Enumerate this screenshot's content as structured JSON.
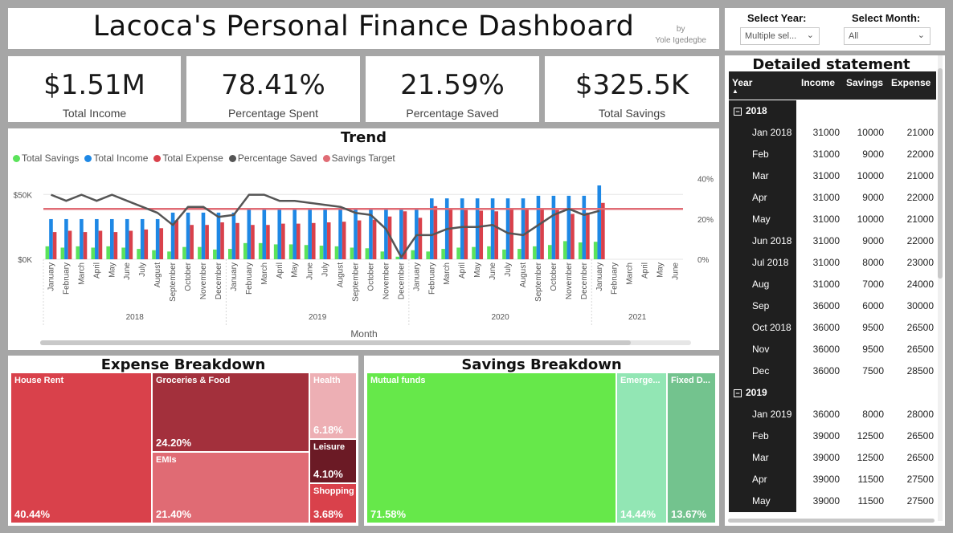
{
  "header": {
    "title": "Lacoca's Personal Finance Dashboard",
    "by_label": "by",
    "author": "Yole Igedegbe"
  },
  "filters": {
    "year_label": "Select Year:",
    "year_value": "Multiple sel...",
    "month_label": "Select Month:",
    "month_value": "All"
  },
  "kpis": [
    {
      "value": "$1.51M",
      "label": "Total Income"
    },
    {
      "value": "78.41%",
      "label": "Percentage Spent"
    },
    {
      "value": "21.59%",
      "label": "Percentage Saved"
    },
    {
      "value": "$325.5K",
      "label": "Total Savings"
    }
  ],
  "trend": {
    "title": "Trend",
    "legend": [
      {
        "name": "Total Savings",
        "color": "#5be35b"
      },
      {
        "name": "Total Income",
        "color": "#1e88e5"
      },
      {
        "name": "Total Expense",
        "color": "#d9414b"
      },
      {
        "name": "Percentage Saved",
        "color": "#555555"
      },
      {
        "name": "Savings Target",
        "color": "#e06c75"
      }
    ],
    "y_left_ticks": [
      "$50K",
      "$0K"
    ],
    "y_right_ticks": [
      "40%",
      "20%",
      "0%"
    ],
    "x_title": "Month",
    "years": [
      "2018",
      "2019",
      "2020",
      "2021"
    ]
  },
  "chart_data": {
    "type": "bar",
    "title": "Trend",
    "xlabel": "Month",
    "ylabel": "",
    "ylim": [
      0,
      70000
    ],
    "y2lim": [
      0,
      0.45
    ],
    "categories": [
      "January",
      "February",
      "March",
      "April",
      "May",
      "June",
      "July",
      "August",
      "September",
      "October",
      "November",
      "December",
      "January",
      "February",
      "March",
      "April",
      "May",
      "June",
      "July",
      "August",
      "September",
      "October",
      "November",
      "December",
      "January",
      "February",
      "March",
      "April",
      "May",
      "June",
      "July",
      "August",
      "September",
      "October",
      "November",
      "December",
      "January",
      "February",
      "March",
      "April",
      "May",
      "June"
    ],
    "category_years": [
      "2018",
      "2018",
      "2018",
      "2018",
      "2018",
      "2018",
      "2018",
      "2018",
      "2018",
      "2018",
      "2018",
      "2018",
      "2019",
      "2019",
      "2019",
      "2019",
      "2019",
      "2019",
      "2019",
      "2019",
      "2019",
      "2019",
      "2019",
      "2019",
      "2020",
      "2020",
      "2020",
      "2020",
      "2020",
      "2020",
      "2020",
      "2020",
      "2020",
      "2020",
      "2020",
      "2020",
      "2021",
      "2021",
      "2021",
      "2021",
      "2021",
      "2021"
    ],
    "series": [
      {
        "name": "Total Savings",
        "axis": "left",
        "kind": "bar",
        "values": [
          10000,
          9000,
          10000,
          9000,
          10000,
          9000,
          8000,
          7000,
          6000,
          9500,
          9500,
          7500,
          8000,
          12500,
          12500,
          11500,
          11500,
          11000,
          10500,
          10000,
          9000,
          8500,
          6000,
          2000,
          7000,
          6000,
          8000,
          9000,
          9500,
          10000,
          7500,
          8000,
          10000,
          11000,
          14000,
          13000,
          13500,
          null,
          null,
          null,
          null,
          null
        ]
      },
      {
        "name": "Total Income",
        "axis": "left",
        "kind": "bar",
        "values": [
          31000,
          31000,
          31000,
          31000,
          31000,
          31000,
          31000,
          31000,
          36000,
          36000,
          36000,
          36000,
          36000,
          39000,
          39000,
          39000,
          39000,
          39000,
          39000,
          39000,
          39000,
          39000,
          39000,
          39000,
          39000,
          47000,
          47000,
          47000,
          47000,
          47000,
          47000,
          47000,
          49000,
          49000,
          49000,
          49000,
          57000,
          null,
          null,
          null,
          null,
          null
        ]
      },
      {
        "name": "Total Expense",
        "axis": "left",
        "kind": "bar",
        "values": [
          21000,
          22000,
          21000,
          22000,
          21000,
          22000,
          23000,
          24000,
          30000,
          26500,
          26500,
          28500,
          28000,
          26500,
          26500,
          27500,
          27500,
          28000,
          28500,
          29000,
          30000,
          30500,
          33000,
          37000,
          32000,
          41000,
          39000,
          38000,
          37500,
          37000,
          39500,
          39000,
          39000,
          38000,
          35000,
          36000,
          43500,
          null,
          null,
          null,
          null,
          null
        ]
      },
      {
        "name": "Percentage Saved",
        "axis": "right",
        "kind": "line",
        "values": [
          0.32,
          0.29,
          0.32,
          0.29,
          0.32,
          0.29,
          0.26,
          0.23,
          0.17,
          0.26,
          0.26,
          0.21,
          0.22,
          0.32,
          0.32,
          0.29,
          0.29,
          0.28,
          0.27,
          0.26,
          0.23,
          0.22,
          0.15,
          0.01,
          0.12,
          0.12,
          0.15,
          0.16,
          0.16,
          0.17,
          0.13,
          0.12,
          0.17,
          0.22,
          0.25,
          0.22,
          0.24,
          null,
          null,
          null,
          null,
          null
        ]
      },
      {
        "name": "Savings Target",
        "axis": "right",
        "kind": "line",
        "values": 0.25
      }
    ]
  },
  "expense_breakdown": {
    "title": "Expense Breakdown",
    "items": [
      {
        "name": "House Rent",
        "value": "40.44%",
        "color": "#d9414b"
      },
      {
        "name": "Groceries & Food",
        "value": "24.20%",
        "color": "#a3303c"
      },
      {
        "name": "EMIs",
        "value": "21.40%",
        "color": "#e06b74"
      },
      {
        "name": "Health",
        "value": "6.18%",
        "color": "#edafb4"
      },
      {
        "name": "Leisure",
        "value": "4.10%",
        "color": "#6b1a25"
      },
      {
        "name": "Shopping",
        "value": "3.68%",
        "color": "#d9414b"
      }
    ]
  },
  "savings_breakdown": {
    "title": "Savings Breakdown",
    "items": [
      {
        "name": "Mutual funds",
        "value": "71.58%",
        "color": "#66e84a"
      },
      {
        "name": "Emerge...",
        "value": "14.44%",
        "color": "#92e6b4"
      },
      {
        "name": "Fixed D...",
        "value": "13.67%",
        "color": "#73c38e"
      }
    ]
  },
  "statement": {
    "title": "Detailed statement",
    "columns": [
      "Year",
      "Income",
      "Savings",
      "Expense"
    ],
    "rows": [
      {
        "type": "group",
        "label": "2018"
      },
      {
        "type": "data",
        "label": "Jan 2018",
        "income": "31000",
        "savings": "10000",
        "expense": "21000"
      },
      {
        "type": "data",
        "label": "Feb",
        "income": "31000",
        "savings": "9000",
        "expense": "22000"
      },
      {
        "type": "data",
        "label": "Mar",
        "income": "31000",
        "savings": "10000",
        "expense": "21000"
      },
      {
        "type": "data",
        "label": "Apr",
        "income": "31000",
        "savings": "9000",
        "expense": "22000"
      },
      {
        "type": "data",
        "label": "May",
        "income": "31000",
        "savings": "10000",
        "expense": "21000"
      },
      {
        "type": "data",
        "label": "Jun 2018",
        "income": "31000",
        "savings": "9000",
        "expense": "22000"
      },
      {
        "type": "data",
        "label": "Jul 2018",
        "income": "31000",
        "savings": "8000",
        "expense": "23000"
      },
      {
        "type": "data",
        "label": "Aug",
        "income": "31000",
        "savings": "7000",
        "expense": "24000"
      },
      {
        "type": "data",
        "label": "Sep",
        "income": "36000",
        "savings": "6000",
        "expense": "30000"
      },
      {
        "type": "data",
        "label": "Oct 2018",
        "income": "36000",
        "savings": "9500",
        "expense": "26500"
      },
      {
        "type": "data",
        "label": "Nov",
        "income": "36000",
        "savings": "9500",
        "expense": "26500"
      },
      {
        "type": "data",
        "label": "Dec",
        "income": "36000",
        "savings": "7500",
        "expense": "28500"
      },
      {
        "type": "group",
        "label": "2019"
      },
      {
        "type": "data",
        "label": "Jan 2019",
        "income": "36000",
        "savings": "8000",
        "expense": "28000"
      },
      {
        "type": "data",
        "label": "Feb",
        "income": "39000",
        "savings": "12500",
        "expense": "26500"
      },
      {
        "type": "data",
        "label": "Mar",
        "income": "39000",
        "savings": "12500",
        "expense": "26500"
      },
      {
        "type": "data",
        "label": "Apr",
        "income": "39000",
        "savings": "11500",
        "expense": "27500"
      },
      {
        "type": "data",
        "label": "May",
        "income": "39000",
        "savings": "11500",
        "expense": "27500"
      }
    ]
  }
}
